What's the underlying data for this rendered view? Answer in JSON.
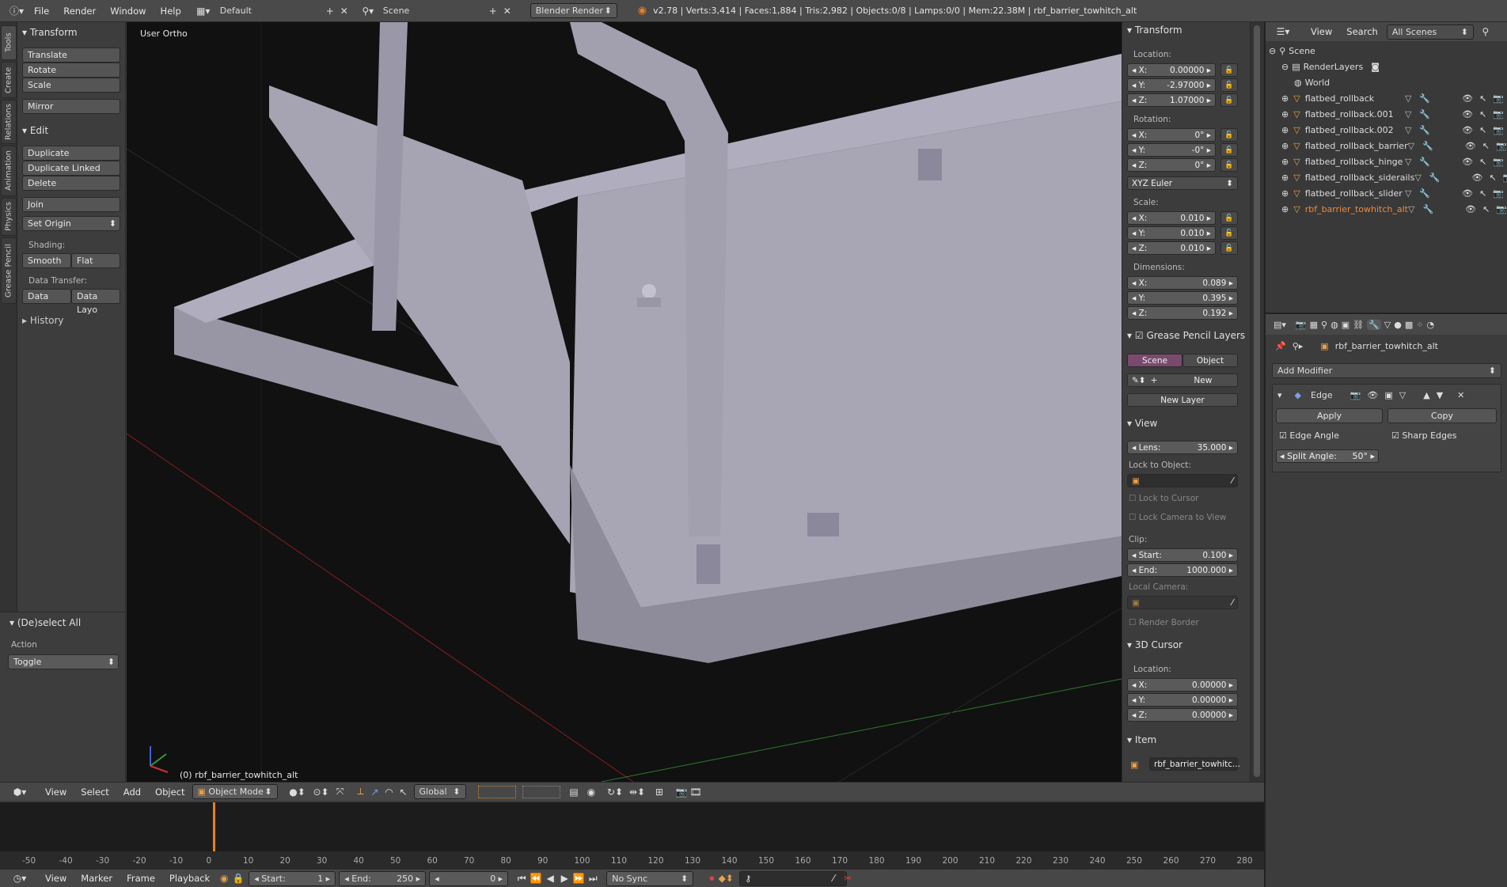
{
  "topbar": {
    "menus": [
      "File",
      "Render",
      "Window",
      "Help"
    ],
    "layout": "Default",
    "scene": "Scene",
    "engine": "Blender Render",
    "stats": "v2.78 | Verts:3,414 | Faces:1,884 | Tris:2,982 | Objects:0/8 | Lamps:0/0 | Mem:22.38M | rbf_barrier_towhitch_alt"
  },
  "vtabs": [
    "Tools",
    "Create",
    "Relations",
    "Animation",
    "Physics",
    "Grease Pencil"
  ],
  "toolshelf": {
    "transform_header": "Transform",
    "transform_buttons": [
      "Translate",
      "Rotate",
      "Scale"
    ],
    "mirror": "Mirror",
    "edit_header": "Edit",
    "edit_buttons": [
      "Duplicate",
      "Duplicate Linked",
      "Delete"
    ],
    "join": "Join",
    "set_origin": "Set Origin",
    "shading_label": "Shading:",
    "smooth": "Smooth",
    "flat": "Flat",
    "data_transfer_label": "Data Transfer:",
    "data": "Data",
    "data_layo": "Data Layo",
    "history": "History"
  },
  "operator": {
    "title": "(De)select All",
    "action_label": "Action",
    "action_value": "Toggle"
  },
  "viewport": {
    "view_label": "User Ortho",
    "object_label": "(0) rbf_barrier_towhitch_alt"
  },
  "npanel": {
    "transform": "Transform",
    "location": "Location:",
    "loc": [
      {
        "axis": "X:",
        "value": "0.00000"
      },
      {
        "axis": "Y:",
        "value": "-2.97000"
      },
      {
        "axis": "Z:",
        "value": "1.07000"
      }
    ],
    "rotation": "Rotation:",
    "rot": [
      {
        "axis": "X:",
        "value": "0°"
      },
      {
        "axis": "Y:",
        "value": "-0°"
      },
      {
        "axis": "Z:",
        "value": "0°"
      }
    ],
    "rotation_mode": "XYZ Euler",
    "scale": "Scale:",
    "scl": [
      {
        "axis": "X:",
        "value": "0.010"
      },
      {
        "axis": "Y:",
        "value": "0.010"
      },
      {
        "axis": "Z:",
        "value": "0.010"
      }
    ],
    "dimensions": "Dimensions:",
    "dim": [
      {
        "axis": "X:",
        "value": "0.089"
      },
      {
        "axis": "Y:",
        "value": "0.395"
      },
      {
        "axis": "Z:",
        "value": "0.192"
      }
    ],
    "gp_layers": "Grease Pencil Layers",
    "gp_scene": "Scene",
    "gp_object": "Object",
    "gp_new": "New",
    "gp_new_layer": "New Layer",
    "view": "View",
    "lens_label": "Lens:",
    "lens_value": "35.000",
    "lock_to_object": "Lock to Object:",
    "lock_to_cursor": "Lock to Cursor",
    "lock_camera": "Lock Camera to View",
    "clip": "Clip:",
    "clip_start_label": "Start:",
    "clip_start": "0.100",
    "clip_end_label": "End:",
    "clip_end": "1000.000",
    "local_camera": "Local Camera:",
    "render_border": "Render Border",
    "cursor": "3D Cursor",
    "cursor_location": "Location:",
    "cur": [
      {
        "axis": "X:",
        "value": "0.00000"
      },
      {
        "axis": "Y:",
        "value": "0.00000"
      },
      {
        "axis": "Z:",
        "value": "0.00000"
      }
    ],
    "item": "Item",
    "item_name": "rbf_barrier_towhitc..."
  },
  "outliner": {
    "view": "View",
    "search": "Search",
    "filter": "All Scenes",
    "scene": "Scene",
    "renderlayers": "RenderLayers",
    "world": "World",
    "objects": [
      {
        "name": "flatbed_rollback",
        "active": false
      },
      {
        "name": "flatbed_rollback.001",
        "active": false
      },
      {
        "name": "flatbed_rollback.002",
        "active": false
      },
      {
        "name": "flatbed_rollback_barrier",
        "active": false
      },
      {
        "name": "flatbed_rollback_hinge",
        "active": false
      },
      {
        "name": "flatbed_rollback_siderails",
        "active": false
      },
      {
        "name": "flatbed_rollback_slider",
        "active": false
      },
      {
        "name": "rbf_barrier_towhitch_alt",
        "active": true
      }
    ]
  },
  "props": {
    "object_name": "rbf_barrier_towhitch_alt",
    "add_modifier": "Add Modifier",
    "modifier_name": "Edge",
    "apply": "Apply",
    "copy": "Copy",
    "edge_angle": "Edge Angle",
    "sharp_edges": "Sharp Edges",
    "split_angle_label": "Split Angle:",
    "split_angle_value": "50°"
  },
  "viewport_header": {
    "menus": [
      "View",
      "Select",
      "Add",
      "Object"
    ],
    "mode": "Object Mode",
    "orientation": "Global"
  },
  "timeline": {
    "ticks": [
      "-50",
      "-40",
      "-30",
      "-20",
      "-10",
      "0",
      "10",
      "20",
      "30",
      "40",
      "50",
      "60",
      "70",
      "80",
      "90",
      "100",
      "110",
      "120",
      "130",
      "140",
      "150",
      "160",
      "170",
      "180",
      "190",
      "200",
      "210",
      "220",
      "230",
      "240",
      "250",
      "260",
      "270",
      "280"
    ],
    "current_frame_marker": 0
  },
  "timeline_header": {
    "menus": [
      "View",
      "Marker",
      "Frame",
      "Playback"
    ],
    "start_label": "Start:",
    "start": "1",
    "end_label": "End:",
    "end": "250",
    "current": "0",
    "sync": "No Sync"
  },
  "colors": {
    "accent": "#e67e22",
    "active_object": "#f0883a",
    "selected_tab": "#7a4a6e",
    "background": "#393939"
  }
}
